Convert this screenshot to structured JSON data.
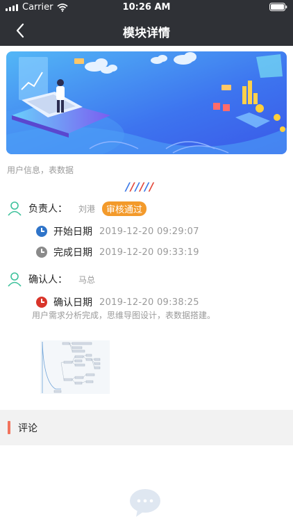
{
  "status_bar": {
    "carrier": "Carrier",
    "time": "10:26 AM"
  },
  "navbar": {
    "title": "模块详情",
    "back_icon": "chevron-left-icon"
  },
  "module": {
    "subtitle": "用户信息，表数据",
    "divider": "//////",
    "divider_colors": [
      "#3b78e7",
      "#e2473a",
      "#3b78e7",
      "#e2473a",
      "#3b78e7",
      "#e2473a"
    ]
  },
  "owner": {
    "label": "负责人：",
    "name": "刘港",
    "status": "审核通过",
    "status_color": "#f39a2b",
    "start_label": "开始日期",
    "start_value": "2019-12-20 09:29:07",
    "start_color": "#2f74c9",
    "finish_label": "完成日期",
    "finish_value": "2019-12-20 09:33:19",
    "finish_color": "#8a8a8a"
  },
  "confirm": {
    "label": "确认人：",
    "name": "马总",
    "date_label": "确认日期",
    "date_value": "2019-12-20 09:38:25",
    "date_color": "#d9352a",
    "description": "用户需求分析完成，思维导图设计，表数据搭建。"
  },
  "comments": {
    "title": "评论"
  },
  "colors": {
    "nav_bg": "#2f3136",
    "accent": "#f2735d",
    "person_icon": "#3cc19b"
  }
}
